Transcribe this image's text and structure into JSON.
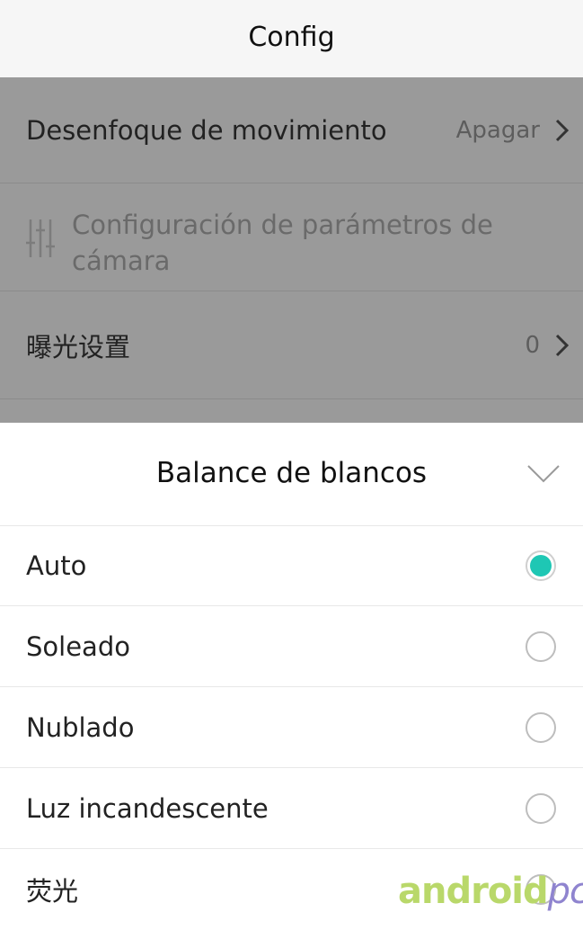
{
  "header": {
    "title": "Config"
  },
  "settings": {
    "motion_blur": {
      "label": "Desenfoque de movimiento",
      "value": "Apagar"
    },
    "camera_params": {
      "label": "Configuración de parámetros de cámara"
    },
    "exposure": {
      "label": "曝光设置",
      "value": "0"
    }
  },
  "white_balance": {
    "title": "Balance de blancos",
    "options": [
      {
        "label": "Auto",
        "selected": true
      },
      {
        "label": "Soleado",
        "selected": false
      },
      {
        "label": "Nublado",
        "selected": false
      },
      {
        "label": "Luz incandescente",
        "selected": false
      },
      {
        "label": "荧光",
        "selected": false
      }
    ],
    "accent_color": "#1ec7b4"
  },
  "watermark": {
    "part1": "android",
    "part2": "pc"
  },
  "icons": [
    "chevron-right-icon",
    "sliders-icon",
    "chevron-down-icon",
    "radio-icon"
  ]
}
